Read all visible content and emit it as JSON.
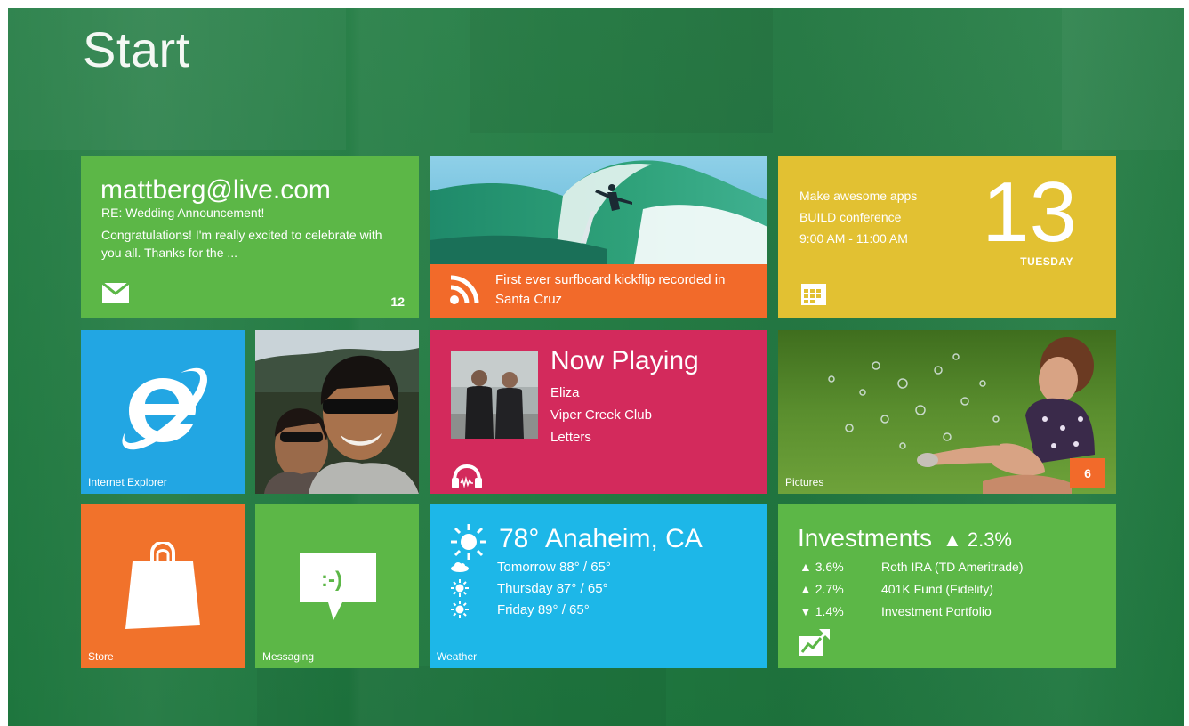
{
  "start": {
    "title": "Start"
  },
  "colors": {
    "background": "#1f7a40",
    "green": "#5cb747",
    "orange": "#f26a2a",
    "yellow": "#e2c132",
    "blue": "#22a6e3",
    "crimson": "#d32a5c"
  },
  "tiles": {
    "mail": {
      "address": "mattberg@live.com",
      "subject": "RE: Wedding Announcement!",
      "body": "Congratulations! I'm really excited to celebrate with you all. Thanks for the ...",
      "count": "12",
      "icon": "envelope-icon"
    },
    "news": {
      "headline": "First ever surfboard kickflip recorded in Santa Cruz",
      "icon": "rss-icon"
    },
    "calendar": {
      "event_line1": "Make awesome apps",
      "event_line2": "BUILD conference",
      "event_line3": "9:00 AM - 11:00 AM",
      "day_number": "13",
      "weekday": "TUESDAY",
      "icon": "calendar-icon"
    },
    "ie": {
      "label": "Internet Explorer",
      "icon": "internet-explorer-icon"
    },
    "music": {
      "title": "Now Playing",
      "artist": "Eliza",
      "album": "Viper Creek Club",
      "song": "Letters",
      "icon": "headphones-icon"
    },
    "pictures": {
      "label": "Pictures",
      "count": "6"
    },
    "store": {
      "label": "Store",
      "icon": "shopping-bag-icon"
    },
    "messaging": {
      "label": "Messaging",
      "emoticon": ":-)",
      "icon": "speech-bubble-icon"
    },
    "weather": {
      "current": "78° Anaheim, CA",
      "forecast": [
        {
          "text": "Tomorrow  88° / 65°",
          "icon": "cloud-icon"
        },
        {
          "text": "Thursday  87° / 65°",
          "icon": "sun-icon"
        },
        {
          "text": "Friday  89° / 65°",
          "icon": "sun-icon"
        }
      ],
      "label": "Weather"
    },
    "finance": {
      "title": "Investments",
      "change": "▲ 2.3%",
      "rows": [
        {
          "pct": "▲ 3.6%",
          "name": "Roth IRA (TD Ameritrade)"
        },
        {
          "pct": "▲ 2.7%",
          "name": "401K Fund (Fidelity)"
        },
        {
          "pct": "▼ 1.4%",
          "name": "Investment Portfolio"
        }
      ],
      "icon": "chart-up-icon"
    }
  }
}
